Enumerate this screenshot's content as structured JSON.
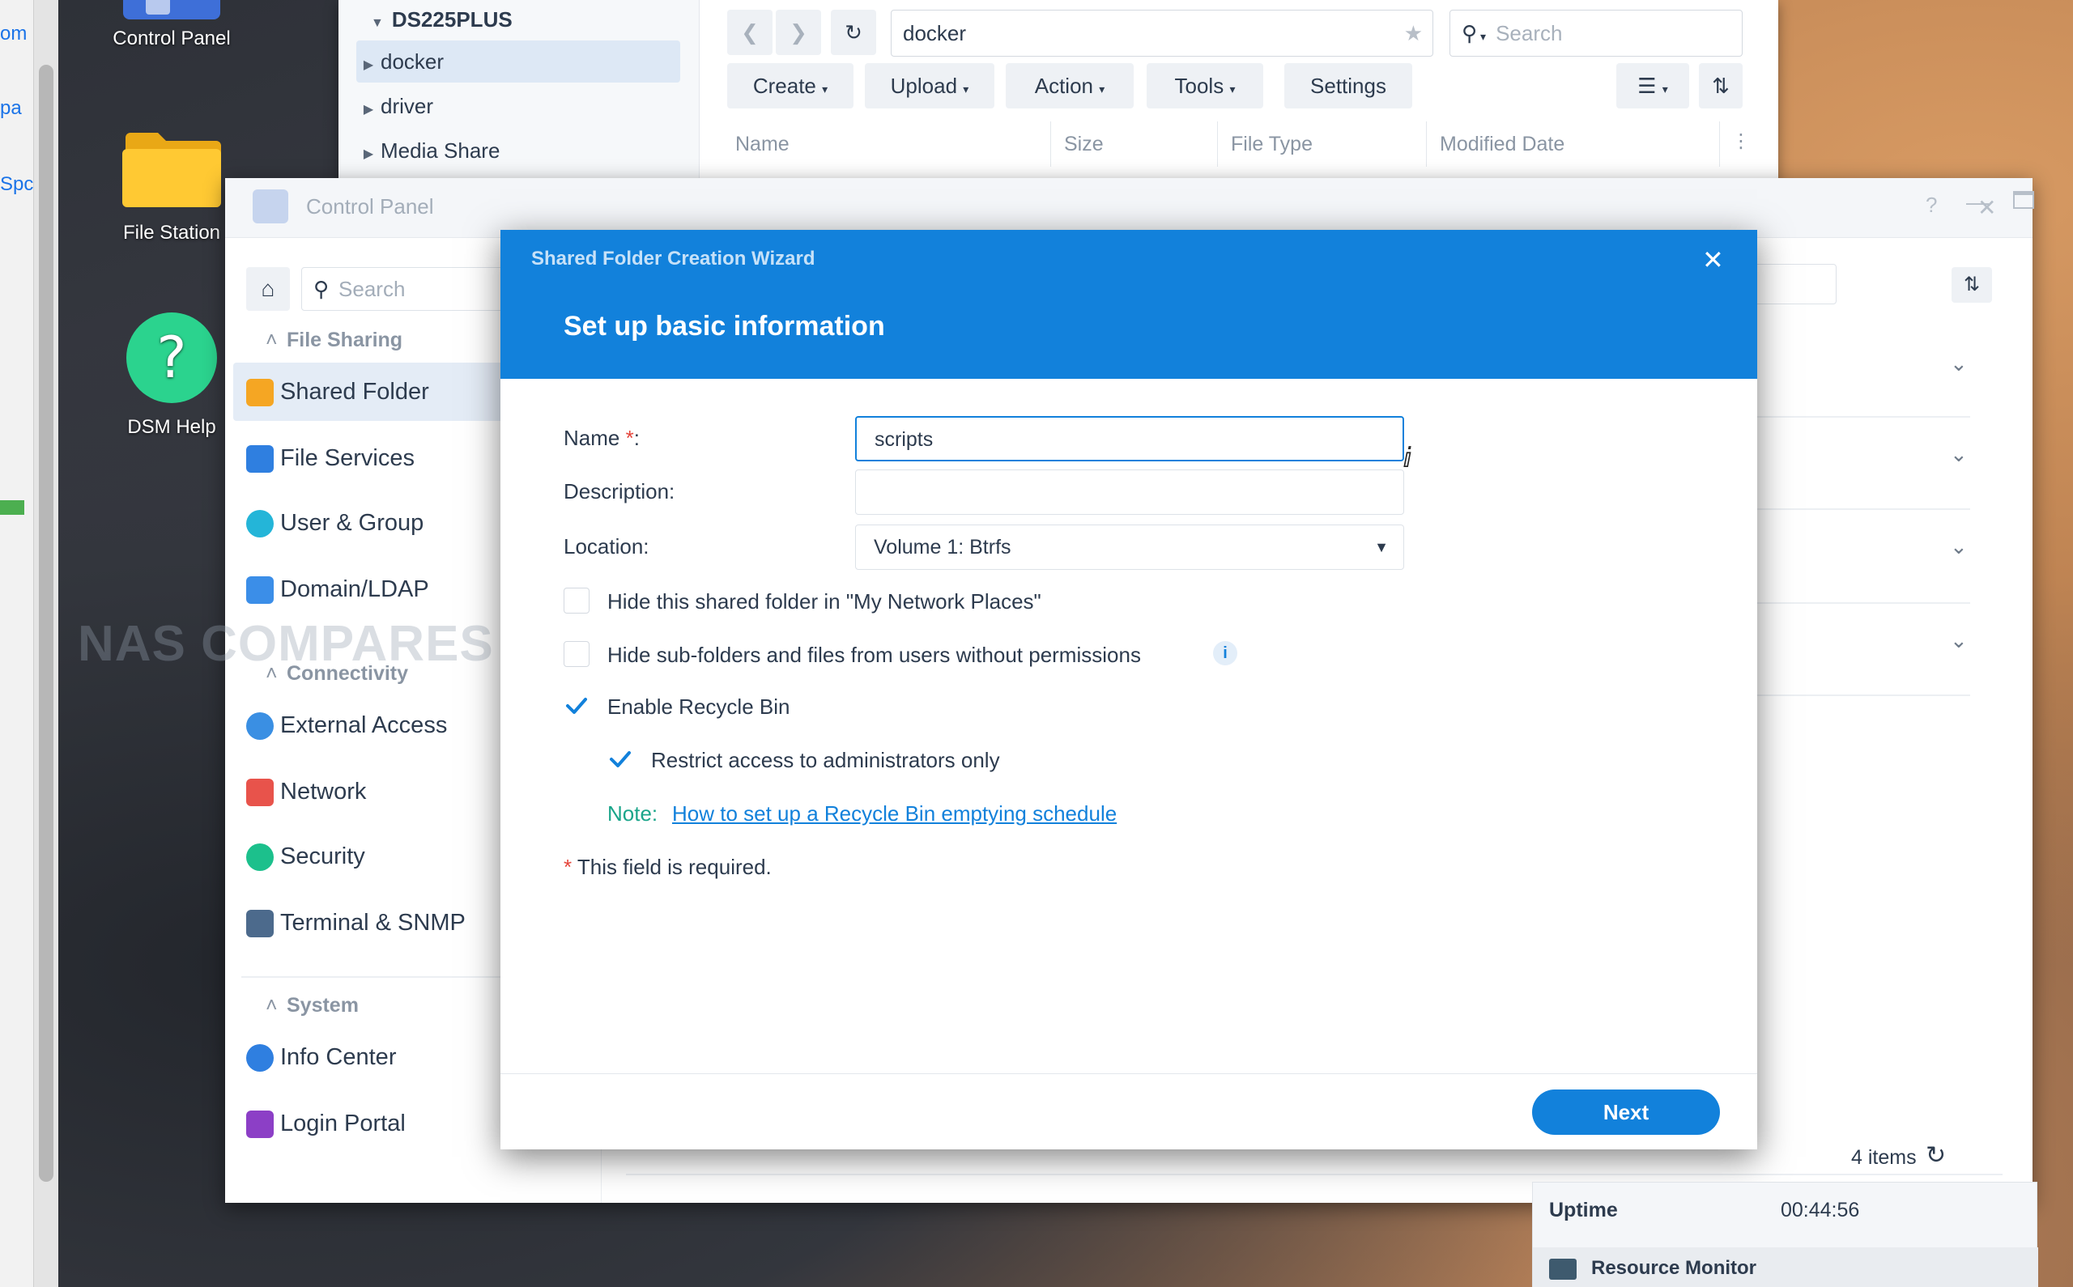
{
  "left_sliver": {
    "fragments": [
      "om",
      "pa",
      "Spc"
    ]
  },
  "desktop_icons": [
    {
      "label": "Control Panel"
    },
    {
      "label": "File Station"
    },
    {
      "label": "DSM Help"
    }
  ],
  "file_station": {
    "tree_root": "DS225PLUS",
    "tree_items": [
      "docker",
      "driver",
      "Media Share"
    ],
    "path": "docker",
    "search_placeholder": "Search",
    "toolbar": {
      "create": "Create",
      "upload": "Upload",
      "action": "Action",
      "tools": "Tools",
      "settings": "Settings"
    },
    "columns": [
      "Name",
      "Size",
      "File Type",
      "Modified Date"
    ]
  },
  "control_panel": {
    "title": "Control Panel",
    "search_placeholder": "Search",
    "sections": {
      "file_sharing": "File Sharing",
      "connectivity": "Connectivity",
      "system": "System"
    },
    "nav": {
      "shared_folder": "Shared Folder",
      "file_services": "File Services",
      "user_group": "User & Group",
      "domain_ldap": "Domain/LDAP",
      "external_access": "External Access",
      "network": "Network",
      "security": "Security",
      "terminal_snmp": "Terminal & SNMP",
      "info_center": "Info Center",
      "login_portal": "Login Portal"
    },
    "item_count": "4 items"
  },
  "watermark": "NAS COMPARES",
  "wizard": {
    "window_title": "Shared Folder Creation Wizard",
    "step_title": "Set up basic information",
    "name_label": "Name",
    "name_required_mark": "*",
    "name_value": "scripts",
    "description_label": "Description:",
    "description_value": "",
    "location_label": "Location:",
    "location_value": "Volume 1:  Btrfs",
    "hide_network_places": "Hide this shared folder in \"My Network Places\"",
    "hide_subfolders": "Hide sub-folders and files from users without permissions",
    "enable_recycle_bin": "Enable Recycle Bin",
    "restrict_admins": "Restrict access to administrators only",
    "note_label": "Note:",
    "note_link": "How to set up a Recycle Bin emptying schedule",
    "required_note": "This field is required.",
    "next_label": "Next"
  },
  "resource_widget": {
    "uptime_label": "Uptime",
    "uptime_value": "00:44:56",
    "monitor_label": "Resource Monitor"
  },
  "colors": {
    "accent": "#1281db",
    "required": "#e5453b",
    "note_green": "#1aa58a",
    "link": "#1281db"
  }
}
